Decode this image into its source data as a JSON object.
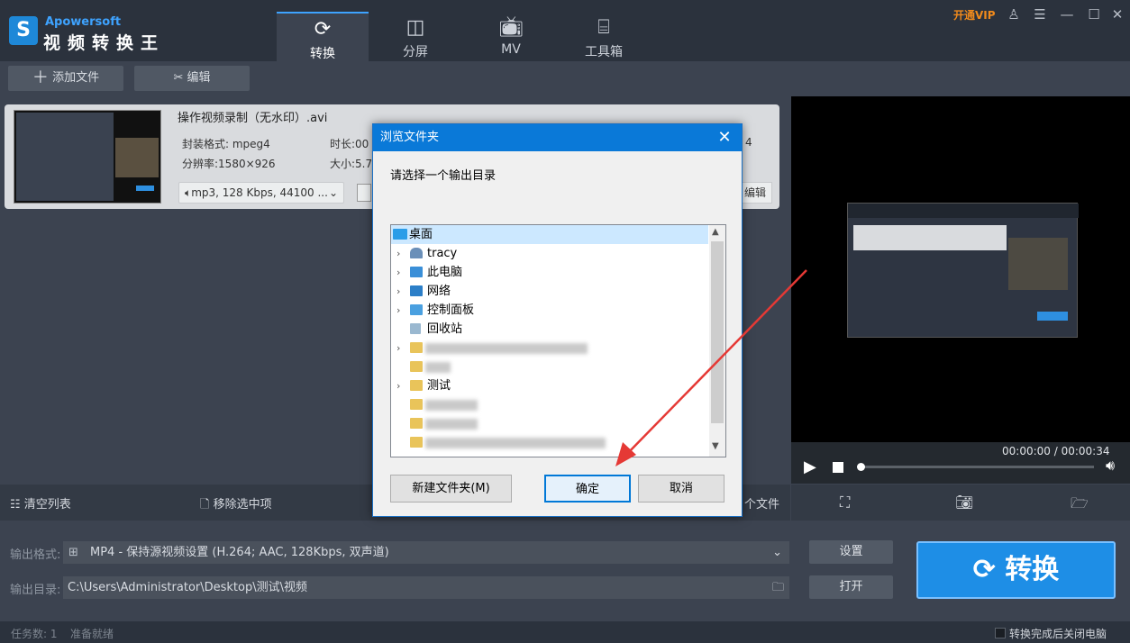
{
  "app": {
    "brand": "Apowersoft",
    "name": "视频转换王",
    "vip": "开通VIP"
  },
  "nav_tabs": [
    {
      "label": "转换",
      "icon": "refresh-icon",
      "active": true
    },
    {
      "label": "分屏",
      "icon": "split-screen-icon"
    },
    {
      "label": "MV",
      "icon": "tv-icon"
    },
    {
      "label": "工具箱",
      "icon": "toolbox-icon"
    }
  ],
  "toolbar": {
    "add_file": "添加文件",
    "edit": "编辑"
  },
  "file": {
    "name": "操作视频录制（无水印）.avi",
    "container_label": "封装格式: mpeg4",
    "duration_label": "时长:00",
    "resolution_label": "分辨率:1580×926",
    "size_label": "大小:5.7",
    "right_partial": "4",
    "audio": "mp3, 128 Kbps, 44100 ...",
    "edit": "编辑"
  },
  "player": {
    "timecode": "00:00:00 / 00:00:34",
    "progress": 0
  },
  "list_actions": {
    "clear": "清空列表",
    "remove": "移除选中项",
    "partial": "个文件"
  },
  "output": {
    "format_label": "输出格式:",
    "format_value": "MP4 - 保持源视频设置 (H.264; AAC, 128Kbps, 双声道)",
    "dir_label": "输出目录:",
    "dir_value": "C:\\Users\\Administrator\\Desktop\\测试\\视频",
    "settings_btn": "设置",
    "open_btn": "打开",
    "convert_btn": "转换"
  },
  "status": {
    "tasks": "任务数: 1",
    "ready": "准备就绪",
    "shutdown": "转换完成后关闭电脑"
  },
  "dialog": {
    "title": "浏览文件夹",
    "prompt": "请选择一个输出目录",
    "tree": [
      {
        "label": "桌面",
        "icon": "desktop-icon"
      },
      {
        "label": "tracy",
        "icon": "user-icon"
      },
      {
        "label": "此电脑",
        "icon": "computer-icon"
      },
      {
        "label": "网络",
        "icon": "network-icon"
      },
      {
        "label": "控制面板",
        "icon": "control-panel-icon"
      },
      {
        "label": "回收站",
        "icon": "recycle-bin-icon"
      },
      {
        "label": "测试",
        "icon": "folder-icon"
      }
    ],
    "new_folder": "新建文件夹(M)",
    "ok": "确定",
    "cancel": "取消"
  },
  "colors": {
    "accent": "#1e8ee6",
    "vip": "#f08a1c",
    "dialog_title": "#0a79d8",
    "arrow": "#e53935"
  }
}
